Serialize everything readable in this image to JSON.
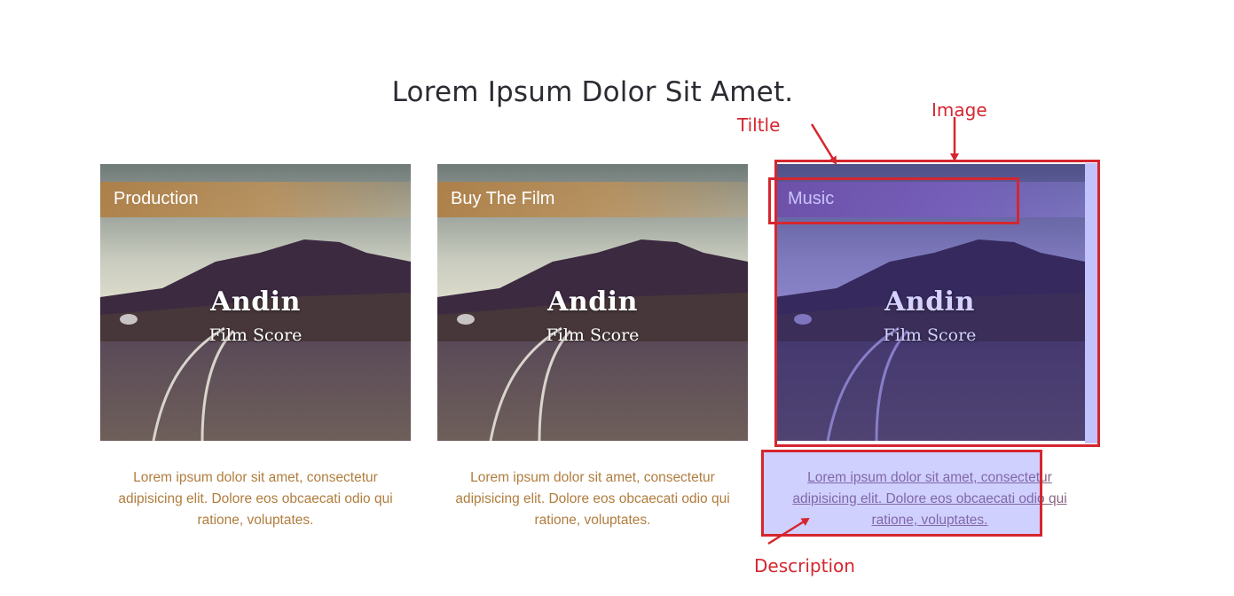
{
  "heading": "Lorem Ipsum Dolor Sit Amet.",
  "cards": [
    {
      "title": "Production",
      "poster_title": "Andin",
      "poster_subtitle": "Film Score",
      "description": "Lorem ipsum dolor sit amet, consectetur adipisicing elit. Dolore eos obcaecati odio qui ratione, voluptates."
    },
    {
      "title": "Buy The Film",
      "poster_title": "Andin",
      "poster_subtitle": "Film Score",
      "description": "Lorem ipsum dolor sit amet, consectetur adipisicing elit. Dolore eos obcaecati odio qui ratione, voluptates."
    },
    {
      "title": "Music",
      "poster_title": "Andin",
      "poster_subtitle": "Film Score",
      "description": "Lorem ipsum dolor sit amet, consectetur adipisicing elit. Dolore eos obcaecati odio qui ratione, voluptates."
    }
  ],
  "annotations": {
    "title_label": "Tiltle",
    "image_label": "Image",
    "description_label": "Description"
  },
  "colors": {
    "heading": "#2b2b33",
    "title_bar": "#b07f44",
    "description_text": "#b07d3e",
    "annotation": "#d5262f",
    "highlight": "#6e6eff"
  }
}
